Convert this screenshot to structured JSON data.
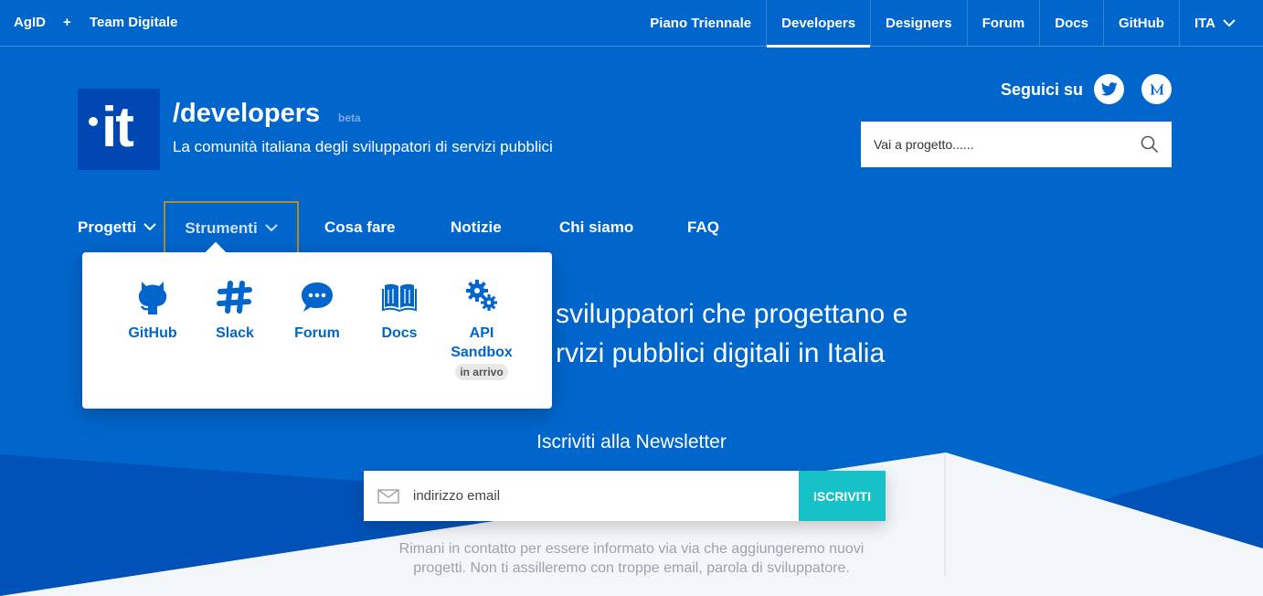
{
  "topbar": {
    "brand_left": "AgID",
    "brand_plus": "+",
    "brand_right": "Team Digitale",
    "nav": [
      {
        "label": "Piano Triennale"
      },
      {
        "label": "Developers",
        "active": true
      },
      {
        "label": "Designers"
      },
      {
        "label": "Forum"
      },
      {
        "label": "Docs"
      },
      {
        "label": "GitHub"
      },
      {
        "label": "ITA"
      }
    ]
  },
  "header": {
    "logo_text": "it",
    "title": "/developers",
    "beta": "beta",
    "tagline": "La comunità italiana degli sviluppatori di servizi pubblici",
    "follow_label": "Seguici su",
    "search_placeholder": "Vai a progetto......"
  },
  "mainnav": {
    "items": [
      {
        "label": "Progetti"
      },
      {
        "label": "Strumenti"
      },
      {
        "label": "Cosa fare"
      },
      {
        "label": "Notizie"
      },
      {
        "label": "Chi siamo"
      },
      {
        "label": "FAQ"
      }
    ]
  },
  "dropdown": {
    "tools": [
      {
        "label": "GitHub",
        "icon": "github-icon"
      },
      {
        "label": "Slack",
        "icon": "slack-icon"
      },
      {
        "label": "Forum",
        "icon": "forum-icon"
      },
      {
        "label": "Docs",
        "icon": "book-icon"
      },
      {
        "label": "API Sandbox",
        "icon": "gears-icon",
        "badge": "in arrivo"
      }
    ]
  },
  "hero": {
    "line1": "sviluppatori che progettano e",
    "line2": "rvizi pubblici digitali in Italia"
  },
  "newsletter": {
    "title": "Iscriviti alla Newsletter",
    "email_placeholder": "indirizzo email",
    "button": "ISCRIVITI",
    "note": "Rimani in contatto per essere informato via via che aggiungeremo nuovi progetti. Non ti assilleremo con troppe email, parola di sviluppatore."
  },
  "colors": {
    "primary": "#0066cc",
    "dark": "#0047b3",
    "accent": "#16c2c8",
    "focus": "#b38a2e"
  }
}
